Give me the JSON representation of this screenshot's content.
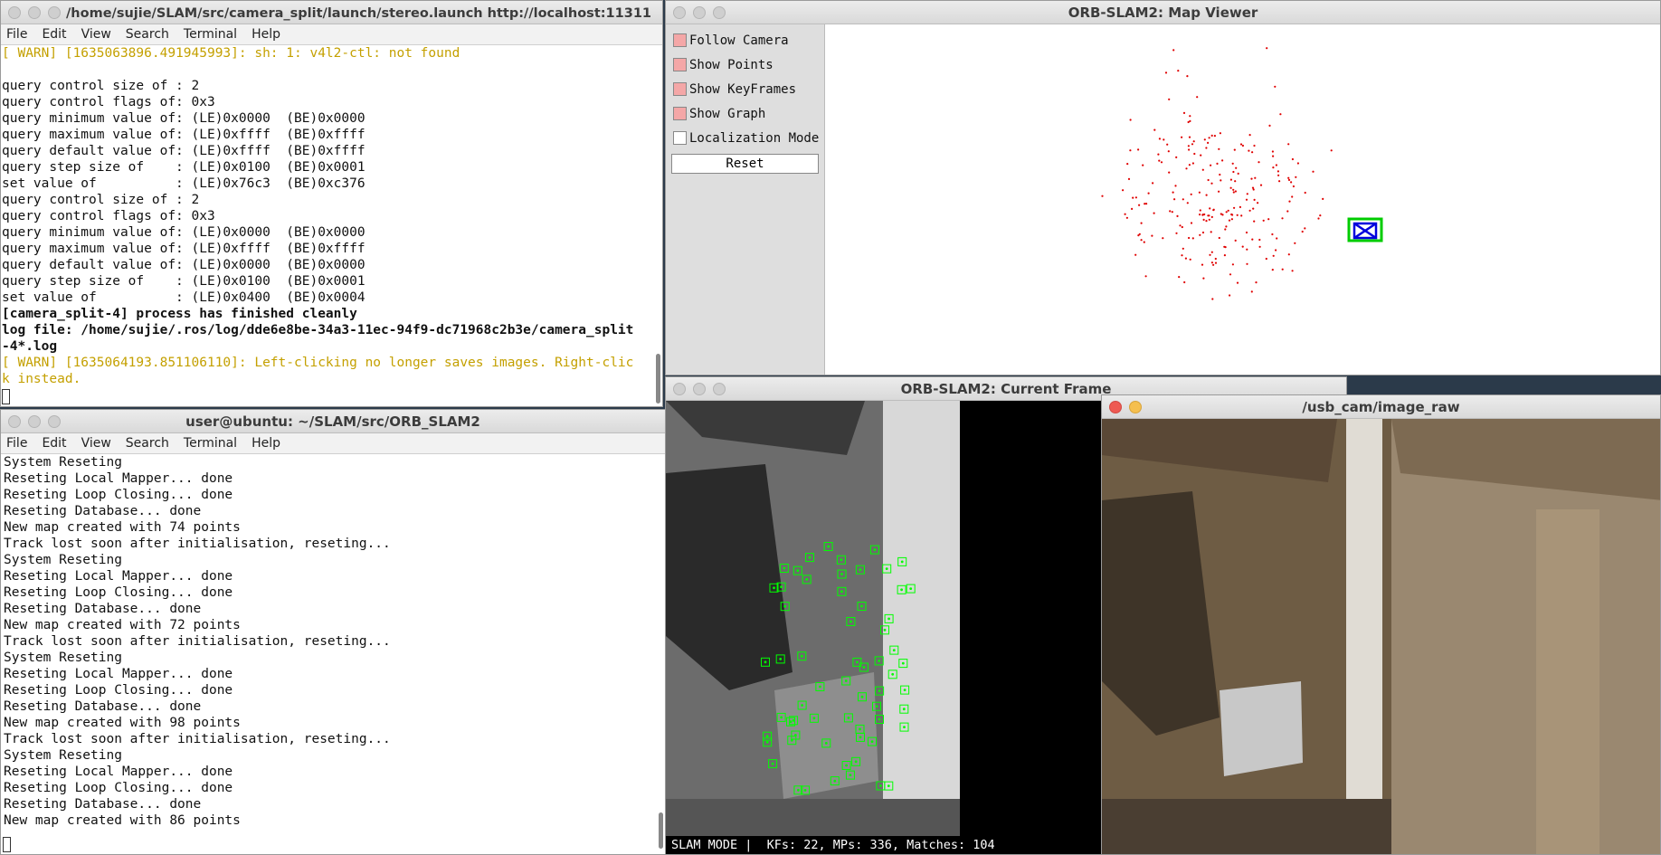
{
  "terminal_top": {
    "title": "/home/sujie/SLAM/src/camera_split/launch/stereo.launch http://localhost:11311",
    "menu": [
      "File",
      "Edit",
      "View",
      "Search",
      "Terminal",
      "Help"
    ],
    "lines": [
      {
        "text": "[ WARN] [1635063896.491945993]: sh: 1: v4l2-ctl: not found",
        "style": "warn"
      },
      {
        "text": "",
        "style": ""
      },
      {
        "text": "query control size of : 2",
        "style": ""
      },
      {
        "text": "query control flags of: 0x3",
        "style": ""
      },
      {
        "text": "query minimum value of: (LE)0x0000  (BE)0x0000",
        "style": ""
      },
      {
        "text": "query maximum value of: (LE)0xffff  (BE)0xffff",
        "style": ""
      },
      {
        "text": "query default value of: (LE)0xffff  (BE)0xffff",
        "style": ""
      },
      {
        "text": "query step size of    : (LE)0x0100  (BE)0x0001",
        "style": ""
      },
      {
        "text": "set value of          : (LE)0x76c3  (BE)0xc376",
        "style": ""
      },
      {
        "text": "query control size of : 2",
        "style": ""
      },
      {
        "text": "query control flags of: 0x3",
        "style": ""
      },
      {
        "text": "query minimum value of: (LE)0x0000  (BE)0x0000",
        "style": ""
      },
      {
        "text": "query maximum value of: (LE)0xffff  (BE)0xffff",
        "style": ""
      },
      {
        "text": "query default value of: (LE)0x0000  (BE)0x0000",
        "style": ""
      },
      {
        "text": "query step size of    : (LE)0x0100  (BE)0x0001",
        "style": ""
      },
      {
        "text": "set value of          : (LE)0x0400  (BE)0x0004",
        "style": ""
      },
      {
        "text": "[camera_split-4] process has finished cleanly",
        "style": "bold"
      },
      {
        "text": "log file: /home/sujie/.ros/log/dde6e8be-34a3-11ec-94f9-dc71968c2b3e/camera_split",
        "style": "bold"
      },
      {
        "text": "-4*.log",
        "style": "bold"
      },
      {
        "text": "[ WARN] [1635064193.851106110]: Left-clicking no longer saves images. Right-clic",
        "style": "warn"
      },
      {
        "text": "k instead.",
        "style": "warn"
      }
    ]
  },
  "terminal_bottom": {
    "title": "user@ubuntu: ~/SLAM/src/ORB_SLAM2",
    "menu": [
      "File",
      "Edit",
      "View",
      "Search",
      "Terminal",
      "Help"
    ],
    "lines": [
      "System Reseting",
      "Reseting Local Mapper... done",
      "Reseting Loop Closing... done",
      "Reseting Database... done",
      "New map created with 74 points",
      "Track lost soon after initialisation, reseting...",
      "System Reseting",
      "Reseting Local Mapper... done",
      "Reseting Loop Closing... done",
      "Reseting Database... done",
      "New map created with 72 points",
      "Track lost soon after initialisation, reseting...",
      "System Reseting",
      "Reseting Local Mapper... done",
      "Reseting Loop Closing... done",
      "Reseting Database... done",
      "New map created with 98 points",
      "Track lost soon after initialisation, reseting...",
      "System Reseting",
      "Reseting Local Mapper... done",
      "Reseting Loop Closing... done",
      "Reseting Database... done",
      "New map created with 86 points"
    ]
  },
  "map_viewer": {
    "title": "ORB-SLAM2: Map Viewer",
    "options": [
      {
        "label": "Follow Camera",
        "checked": true
      },
      {
        "label": "Show Points",
        "checked": true
      },
      {
        "label": "Show KeyFrames",
        "checked": true
      },
      {
        "label": "Show Graph",
        "checked": true
      },
      {
        "label": "Localization Mode",
        "checked": false
      }
    ],
    "reset_label": "Reset",
    "point_color": "#e00000",
    "camera_color": "#00cc00",
    "keyframe_color": "#0000dd"
  },
  "current_frame": {
    "title": "ORB-SLAM2: Current Frame",
    "status": "SLAM MODE |  KFs: 22, MPs: 336, Matches: 104",
    "feature_color": "#00ff00"
  },
  "image_raw": {
    "title": "/usb_cam/image_raw"
  }
}
